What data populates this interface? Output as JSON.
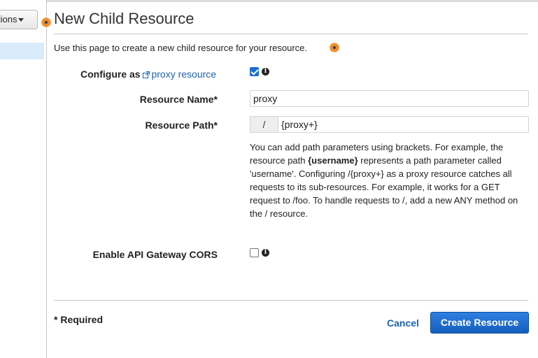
{
  "sidebar": {
    "actions_label": "tions"
  },
  "form": {
    "title": "New Child Resource",
    "intro": "Use this page to create a new child resource for your resource.",
    "configure_label": "Configure as",
    "proxy_link": "proxy resource",
    "configure_checked": true,
    "resource_name_label": "Resource Name*",
    "resource_name_value": "proxy",
    "resource_path_label": "Resource Path*",
    "path_prefix": "/",
    "resource_path_value": "{proxy+}",
    "help": {
      "part1": "You can add path parameters using brackets. For example, the resource path ",
      "bold": "{username}",
      "part2": " represents a path parameter called 'username'. Configuring /{proxy+} as a proxy resource catches all requests to its sub-resources. For example, it works for a GET request to /foo. To handle requests to /, add a new ANY method on the / resource."
    },
    "cors_label": "Enable API Gateway CORS",
    "cors_checked": false,
    "required_note": "* Required",
    "cancel_label": "Cancel",
    "create_label": "Create Resource"
  },
  "icons": {
    "info": "info-icon",
    "external_link": "external-link-icon",
    "highlight_marker": "highlight-dot-icon",
    "caret": "caret-down-icon"
  },
  "colors": {
    "link": "#1a64b4",
    "primary_button": "#145fbf",
    "checkbox_checked": "#1a6fd6",
    "marker": "#f08c2a",
    "sidebar_selected": "#d9ebfa"
  }
}
